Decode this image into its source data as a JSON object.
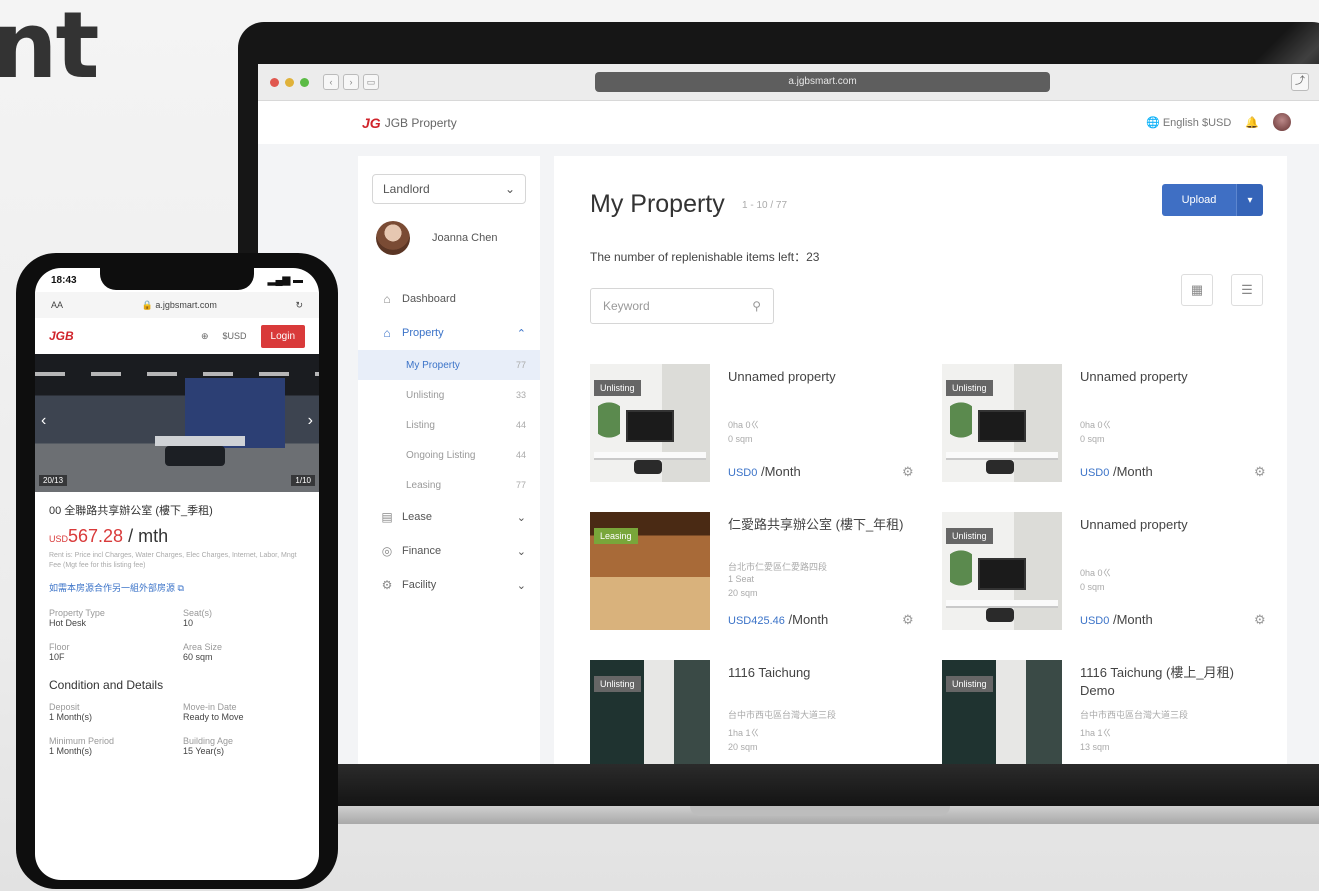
{
  "hero_text": "nt",
  "browser": {
    "url": "a.jgbsmart.com"
  },
  "app": {
    "logo_text": "JGB Property",
    "lang": "English",
    "currency": "$USD"
  },
  "sidebar": {
    "role": "Landlord",
    "user_name": "Joanna Chen",
    "items": [
      {
        "icon": "dashboard-icon",
        "label": "Dashboard"
      },
      {
        "icon": "home-icon",
        "label": "Property",
        "expanded": true
      },
      {
        "icon": "lease-icon",
        "label": "Lease"
      },
      {
        "icon": "finance-icon",
        "label": "Finance"
      },
      {
        "icon": "facility-icon",
        "label": "Facility"
      }
    ],
    "sub_items": [
      {
        "label": "My Property",
        "count": "77"
      },
      {
        "label": "Unlisting",
        "count": "33"
      },
      {
        "label": "Listing",
        "count": "44"
      },
      {
        "label": "Ongoing Listing",
        "count": "44"
      },
      {
        "label": "Leasing",
        "count": "77"
      }
    ]
  },
  "main": {
    "title": "My Property",
    "breadcrumb": "1 - 10 / 77",
    "upload_label": "Upload",
    "replenish_text": "The number of replenishable items left：23",
    "search_placeholder": "Keyword",
    "cards": [
      {
        "badge": "Unlisting",
        "title": "Unnamed property",
        "line1": "0ha  0ㄍ",
        "line2": "0 sqm",
        "currency": "USD",
        "price": "0",
        "unit": "/Month"
      },
      {
        "badge": "Unlisting",
        "title": "Unnamed property",
        "line1": "0ha  0ㄍ",
        "line2": "0 sqm",
        "currency": "USD",
        "price": "0",
        "unit": "/Month"
      },
      {
        "badge": "Leasing",
        "title": "仁愛路共享辦公室 (樓下_年租)",
        "line1": "台北市仁愛區仁愛路四段",
        "line2": "1 Seat",
        "line3": "20 sqm",
        "currency": "USD",
        "price": "425.46",
        "unit": "/Month"
      },
      {
        "badge": "Unlisting",
        "title": "Unnamed property",
        "line1": "0ha  0ㄍ",
        "line2": "0 sqm",
        "currency": "USD",
        "price": "0",
        "unit": "/Month"
      },
      {
        "badge": "Unlisting",
        "title": "1116 Taichung",
        "line1": "台中市西屯區台灣大道三段",
        "line2": "1ha  1ㄍ",
        "line3": "20 sqm"
      },
      {
        "badge": "Unlisting",
        "title": "1116 Taichung (樓上_月租) Demo",
        "line1": "台中市西屯區台灣大道三段",
        "line2": "1ha  1ㄍ",
        "line3": "13 sqm"
      }
    ]
  },
  "phone": {
    "time": "18:43",
    "aa": "AA",
    "url": "a.jgbsmart.com",
    "logo": "JGB",
    "currency": "$USD",
    "login": "Login",
    "photo_left": "20/13",
    "photo_right": "1/10",
    "title": "00 全聯路共享辦公室 (樓下_季租)",
    "price_cur": "USD",
    "price": "567.28",
    "price_unit": " / mth",
    "note": "Rent is: Price incl Charges, Water Charges, Elec Charges, Internet, Labor, Mngt Fee (Mgt fee for this listing fee)",
    "link": "如需本房源合作另一組外部房源",
    "details": [
      {
        "k": "Property Type",
        "v": "Hot Desk"
      },
      {
        "k": "Seat(s)",
        "v": "10"
      },
      {
        "k": "Floor",
        "v": "10F"
      },
      {
        "k": "Area Size",
        "v": "60 sqm"
      }
    ],
    "section": "Condition and Details",
    "details2": [
      {
        "k": "Deposit",
        "v": "1 Month(s)"
      },
      {
        "k": "Move-in Date",
        "v": "Ready to Move"
      },
      {
        "k": "Minimum Period",
        "v": "1 Month(s)"
      },
      {
        "k": "Building Age",
        "v": "15 Year(s)"
      }
    ]
  },
  "colors": {
    "brand_red": "#d0242b",
    "primary_blue": "#3f6fc4",
    "login_red": "#d93a3a"
  }
}
